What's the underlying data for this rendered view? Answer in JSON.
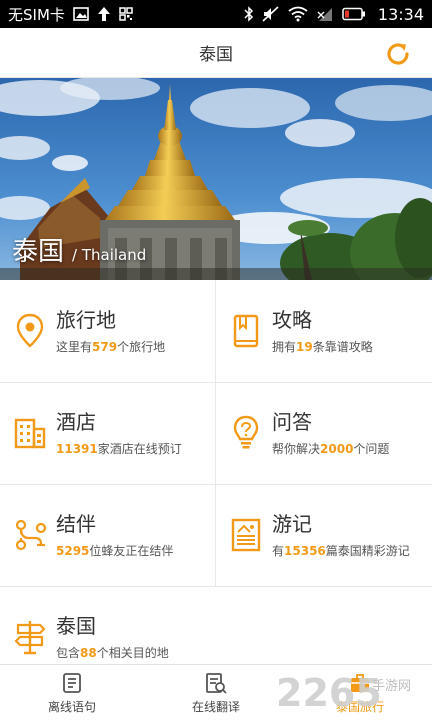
{
  "status_bar": {
    "carrier": "无SIM卡",
    "time": "13:34"
  },
  "header": {
    "title": "泰国"
  },
  "hero": {
    "name": "泰国",
    "name_en": "/ Thailand"
  },
  "grid": [
    {
      "title": "旅行地",
      "pre": "这里有",
      "num": "579",
      "post": "个旅行地",
      "icon": "location-pin-icon"
    },
    {
      "title": "攻略",
      "pre": "拥有",
      "num": "19",
      "post": "条靠谱攻略",
      "icon": "book-icon"
    },
    {
      "title": "酒店",
      "pre": "",
      "num": "11391",
      "post": "家酒店在线预订",
      "icon": "hotel-building-icon"
    },
    {
      "title": "问答",
      "pre": "帮你解决",
      "num": "2000",
      "post": "个问题",
      "icon": "lightbulb-icon"
    },
    {
      "title": "结伴",
      "pre": "",
      "num": "5295",
      "post": "位蜂友正在结伴",
      "icon": "route-icon"
    },
    {
      "title": "游记",
      "pre": "有",
      "num": "15356",
      "post": "篇泰国精彩游记",
      "icon": "travel-note-icon"
    },
    {
      "title": "泰国",
      "pre": "包含",
      "num": "88",
      "post": "个相关目的地",
      "icon": "signpost-icon"
    }
  ],
  "bottom_nav": [
    {
      "label": "离线语句",
      "icon": "offline-phrase-icon",
      "active": false
    },
    {
      "label": "在线翻译",
      "icon": "translate-doc-icon",
      "active": false
    },
    {
      "label": "泰国旅行",
      "icon": "travel-bag-icon",
      "active": true
    }
  ],
  "watermark": "2265 手游网",
  "colors": {
    "accent": "#f29a18",
    "status_bar": "#000000"
  }
}
